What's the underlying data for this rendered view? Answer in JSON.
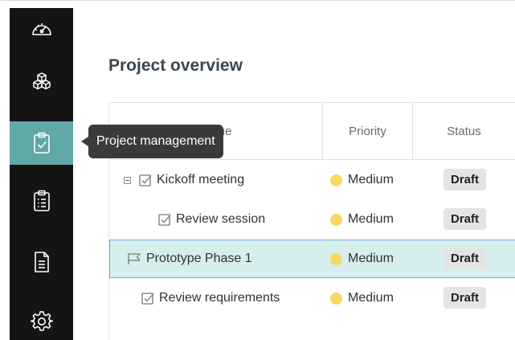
{
  "sidebar": {
    "items": [
      {
        "icon": "dashboard-gauge-icon",
        "label": "Dashboard"
      },
      {
        "icon": "cubes-icon",
        "label": "Components"
      },
      {
        "icon": "clipboard-check-icon",
        "label": "Project management",
        "active": true
      },
      {
        "icon": "clipboard-list-icon",
        "label": "Task list"
      },
      {
        "icon": "document-icon",
        "label": "Documents"
      },
      {
        "icon": "gear-icon",
        "label": "Settings"
      }
    ],
    "active_color": "#5fa8a5"
  },
  "tooltip": {
    "text": "Project management"
  },
  "page": {
    "title": "Project overview"
  },
  "table": {
    "columns": [
      "Name",
      "Priority",
      "Status"
    ],
    "rows": [
      {
        "name": "Kickoff meeting",
        "icon": "task-check-icon",
        "expandable": true,
        "priority": "Medium",
        "priority_color": "#f9d85e",
        "status": "Draft"
      },
      {
        "name": "Review session",
        "icon": "task-check-icon",
        "indent": 1,
        "priority": "Medium",
        "priority_color": "#f9d85e",
        "status": "Draft"
      },
      {
        "name": "Prototype Phase 1",
        "icon": "milestone-flag-icon",
        "selected": true,
        "priority": "Medium",
        "priority_color": "#f9d85e",
        "status": "Draft"
      },
      {
        "name": "Review requirements",
        "icon": "task-check-icon",
        "priority": "Medium",
        "priority_color": "#f9d85e",
        "status": "Draft"
      }
    ]
  }
}
